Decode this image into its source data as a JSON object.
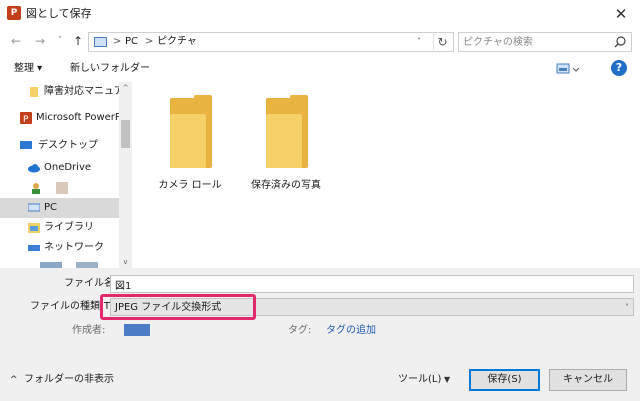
{
  "window": {
    "title": "図として保存",
    "app_icon_letter": "P"
  },
  "nav": {
    "back_icon": "←",
    "forward_icon": "→",
    "recent_icon": "˅",
    "up_icon": "↑",
    "refresh_icon": "↻",
    "breadcrumb": [
      "PC",
      "ピクチャ"
    ],
    "breadcrumb_sep": ">",
    "dropdown_icon": "˅"
  },
  "search": {
    "placeholder": "ピクチャの検索"
  },
  "toolbar": {
    "organize_label": "整理 ▾",
    "new_folder_label": "新しいフォルダー",
    "help_label": "?"
  },
  "sidebar": {
    "items": [
      {
        "label": "障害対応マニュアル",
        "icon": "folder-icon",
        "selected": false
      },
      {
        "label": "Microsoft PowerPoint",
        "icon": "powerpoint-icon",
        "selected": false
      },
      {
        "label": "デスクトップ",
        "icon": "desktop-icon",
        "selected": false
      },
      {
        "label": "OneDrive",
        "icon": "cloud-icon",
        "selected": false
      },
      {
        "label": "",
        "icon": "user-icon",
        "selected": false
      },
      {
        "label": "PC",
        "icon": "computer-icon",
        "selected": true
      },
      {
        "label": "ライブラリ",
        "icon": "library-icon",
        "selected": false
      },
      {
        "label": "ネットワーク",
        "icon": "network-icon",
        "selected": false
      }
    ],
    "scroll_up_icon": "^",
    "scroll_down_icon": "v"
  },
  "content": {
    "folders": [
      {
        "name": "カメラ ロール"
      },
      {
        "name": "保存済みの写真"
      }
    ]
  },
  "form": {
    "filename_label": "ファイル名(N):",
    "filename_value": "図1",
    "filetype_label": "ファイルの種類(T):",
    "filetype_value": "JPEG ファイル交換形式",
    "filetype_arrow": "˅",
    "author_label": "作成者:",
    "tag_label": "タグ:",
    "tag_add": "タグの追加"
  },
  "footer": {
    "hide_folders_icon": "^",
    "hide_folders_label": "フォルダーの非表示",
    "tools_label": "ツール(L)",
    "tools_arrow": "▼",
    "save_label": "保存(S)",
    "cancel_label": "キャンセル"
  },
  "colors": {
    "highlight": "#e2296b",
    "accent": "#0078d7",
    "folder": "#f6d168",
    "tag_link": "#1f5bb0"
  }
}
